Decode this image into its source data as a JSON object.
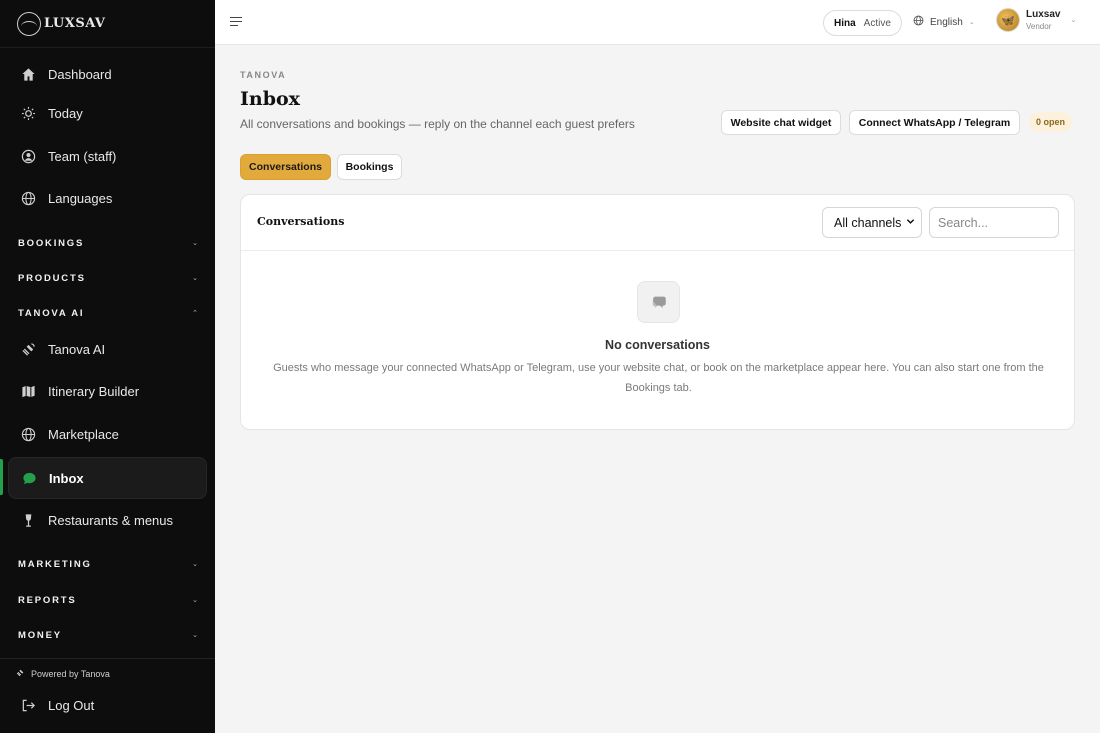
{
  "brand": {
    "name": "LUXSAV"
  },
  "sidebar": {
    "items_top": [
      {
        "label": "Dashboard",
        "icon": "home-icon"
      },
      {
        "label": "Today",
        "icon": "sun-icon"
      },
      {
        "label": "Team (staff)",
        "icon": "team-icon"
      },
      {
        "label": "Languages",
        "icon": "globe-icon"
      }
    ],
    "sections": [
      {
        "label": "BOOKINGS",
        "expanded": false
      },
      {
        "label": "PRODUCTS",
        "expanded": false
      },
      {
        "label": "TANOVA AI",
        "expanded": true
      }
    ],
    "tanova_items": [
      {
        "label": "Tanova AI",
        "icon": "satellite-icon"
      },
      {
        "label": "Itinerary Builder",
        "icon": "map-icon"
      },
      {
        "label": "Marketplace",
        "icon": "globe-icon"
      },
      {
        "label": "Inbox",
        "icon": "chat-icon",
        "active": true
      },
      {
        "label": "Restaurants & menus",
        "icon": "wine-icon"
      }
    ],
    "sections_bottom": [
      {
        "label": "MARKETING"
      },
      {
        "label": "REPORTS"
      },
      {
        "label": "MONEY"
      }
    ],
    "powered_by": "Powered by Tanova",
    "logout": "Log Out",
    "active_color": "#22a04a"
  },
  "topbar": {
    "user_short": "Hina",
    "status": "Active",
    "language": "English",
    "user_name": "Luxsav",
    "user_role": "Vendor"
  },
  "page": {
    "eyebrow": "TANOVA",
    "title": "Inbox",
    "subtitle": "All conversations and bookings — reply on the channel each guest prefers",
    "btn_widget": "Website chat widget",
    "btn_connect": "Connect WhatsApp / Telegram",
    "open_badge": "0 open",
    "tabs": [
      {
        "label": "Conversations",
        "active": true
      },
      {
        "label": "Bookings",
        "active": false
      }
    ],
    "accent": "#e2a93c"
  },
  "card": {
    "title": "Conversations",
    "channel_filter": "All channels",
    "search_placeholder": "Search...",
    "empty_title": "No conversations",
    "empty_text": "Guests who message your connected WhatsApp or Telegram, use your website chat, or book on the marketplace appear here. You can also start one from the Bookings tab."
  }
}
